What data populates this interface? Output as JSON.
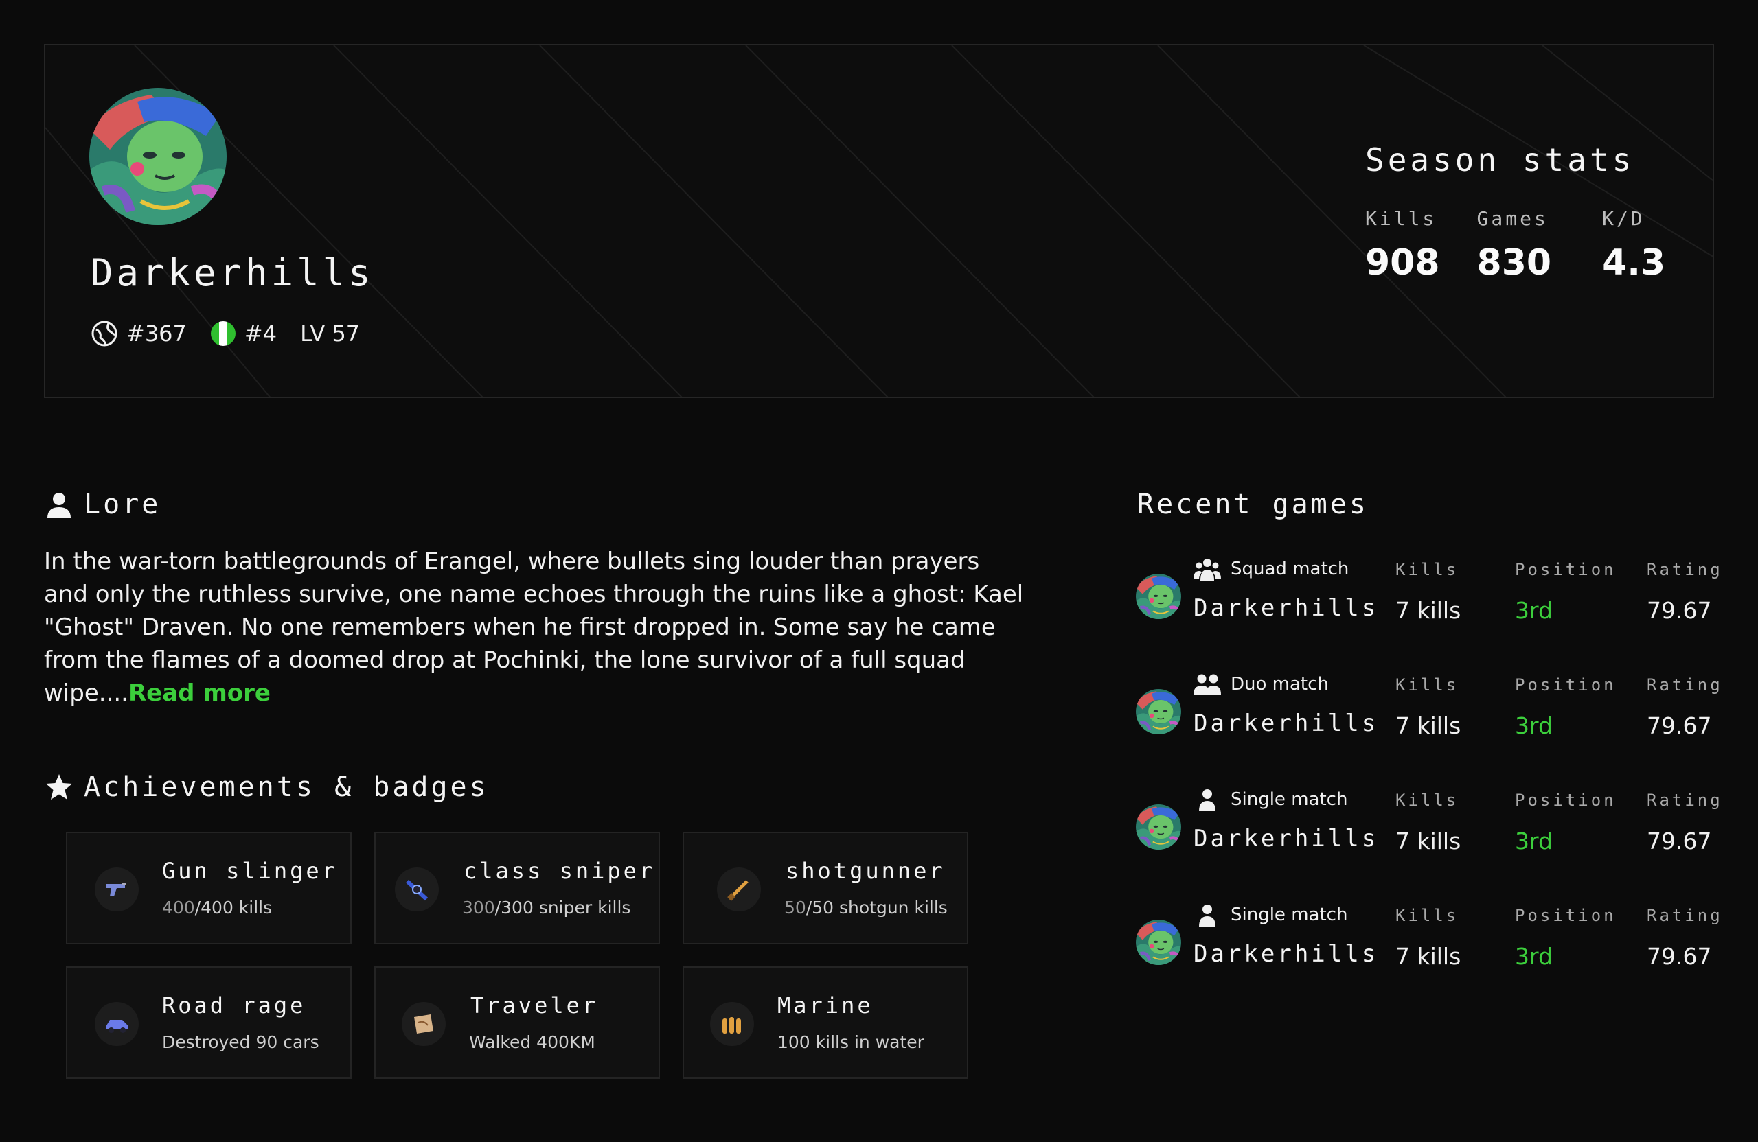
{
  "profile": {
    "name": "Darkerhills",
    "rank_global": "#367",
    "rank_region": "#4",
    "level": "LV 57"
  },
  "season": {
    "title": "Season stats",
    "stats": [
      {
        "label": "Kills",
        "value": "908"
      },
      {
        "label": "Games",
        "value": "830"
      },
      {
        "label": "K/D",
        "value": "4.3"
      }
    ]
  },
  "lore": {
    "title": "Lore",
    "text": "In the war-torn battlegrounds of Erangel, where bullets sing louder than prayers and only the ruthless survive, one name echoes through the ruins like a ghost: Kael \"Ghost\" Draven. No one remembers when he first dropped in. Some say he came from the flames of a doomed drop at Pochinki, the lone survivor of a full squad wipe....",
    "read_more": "Read more"
  },
  "achievements": {
    "title": "Achievements & badges",
    "items": [
      {
        "title": "Gun slinger",
        "progress": "400",
        "rest": "/400 kills",
        "icon": "pistol-icon"
      },
      {
        "title": "class sniper",
        "progress": "300",
        "rest": "/300 sniper kills",
        "icon": "sniper-icon"
      },
      {
        "title": "shotgunner",
        "progress": "50",
        "rest": "/50 shotgun kills",
        "icon": "shotgun-icon"
      },
      {
        "title": "Road rage",
        "progress": "",
        "rest": "Destroyed 90 cars",
        "icon": "car-icon"
      },
      {
        "title": "Traveler",
        "progress": "",
        "rest": "Walked 400KM",
        "icon": "map-icon"
      },
      {
        "title": "Marine",
        "progress": "",
        "rest": "100 kills in water",
        "icon": "bullets-icon"
      }
    ]
  },
  "recent": {
    "title": "Recent games",
    "labels": {
      "kills": "Kills",
      "position": "Position",
      "rating": "Rating"
    },
    "games": [
      {
        "type": "Squad match",
        "player": "Darkerhills",
        "kills": "7 kills",
        "position": "3rd",
        "rating": "79.67"
      },
      {
        "type": "Duo match",
        "player": "Darkerhills",
        "kills": "7 kills",
        "position": "3rd",
        "rating": "79.67"
      },
      {
        "type": "Single match",
        "player": "Darkerhills",
        "kills": "7 kills",
        "position": "3rd",
        "rating": "79.67"
      },
      {
        "type": "Single match",
        "player": "Darkerhills",
        "kills": "7 kills",
        "position": "3rd",
        "rating": "79.67"
      }
    ]
  },
  "colors": {
    "accent": "#3ccf3c",
    "background": "#0b0b0b",
    "card": "#111111"
  }
}
